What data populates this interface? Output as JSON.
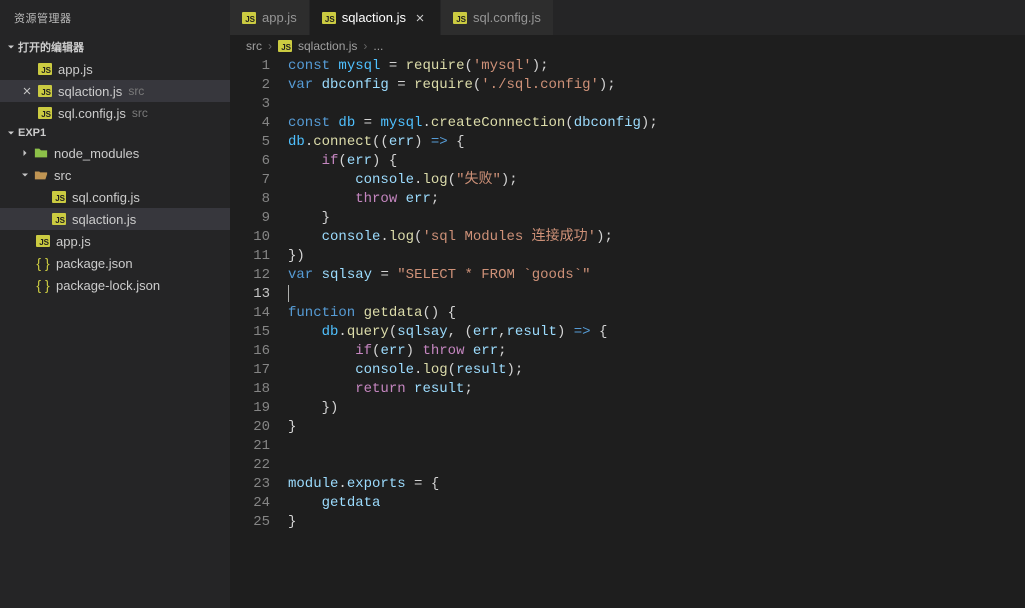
{
  "sidebar": {
    "title": "资源管理器",
    "openEditors": {
      "label": "打开的编辑器",
      "items": [
        {
          "name": "app.js",
          "meta": ""
        },
        {
          "name": "sqlaction.js",
          "meta": "src"
        },
        {
          "name": "sql.config.js",
          "meta": "src"
        }
      ]
    },
    "project": {
      "label": "EXP1",
      "tree": {
        "node_modules": "node_modules",
        "src": "src",
        "src_children": [
          {
            "name": "sql.config.js"
          },
          {
            "name": "sqlaction.js"
          }
        ],
        "root_files": [
          {
            "name": "app.js",
            "icon": "js"
          },
          {
            "name": "package.json",
            "icon": "json"
          },
          {
            "name": "package-lock.json",
            "icon": "json"
          }
        ]
      }
    }
  },
  "tabs": [
    {
      "name": "app.js",
      "active": false
    },
    {
      "name": "sqlaction.js",
      "active": true
    },
    {
      "name": "sql.config.js",
      "active": false
    }
  ],
  "breadcrumb": {
    "parts": [
      "src",
      "sqlaction.js"
    ],
    "ellipsis": "..."
  },
  "code": {
    "lines": [
      {
        "n": 1,
        "tokens": [
          [
            "kw",
            "const"
          ],
          [
            "sp",
            " "
          ],
          [
            "const",
            "mysql"
          ],
          [
            "sp",
            " "
          ],
          [
            "op",
            "="
          ],
          [
            "sp",
            " "
          ],
          [
            "fn",
            "require"
          ],
          [
            "punc",
            "("
          ],
          [
            "str",
            "'mysql'"
          ],
          [
            "punc",
            ");"
          ]
        ]
      },
      {
        "n": 2,
        "tokens": [
          [
            "kw",
            "var"
          ],
          [
            "sp",
            " "
          ],
          [
            "var",
            "dbconfig"
          ],
          [
            "sp",
            " "
          ],
          [
            "op",
            "="
          ],
          [
            "sp",
            " "
          ],
          [
            "fn",
            "require"
          ],
          [
            "punc",
            "("
          ],
          [
            "str",
            "'./sql.config'"
          ],
          [
            "punc",
            ");"
          ]
        ]
      },
      {
        "n": 3,
        "tokens": []
      },
      {
        "n": 4,
        "tokens": [
          [
            "kw",
            "const"
          ],
          [
            "sp",
            " "
          ],
          [
            "const",
            "db"
          ],
          [
            "sp",
            " "
          ],
          [
            "op",
            "="
          ],
          [
            "sp",
            " "
          ],
          [
            "const",
            "mysql"
          ],
          [
            "punc",
            "."
          ],
          [
            "fn",
            "createConnection"
          ],
          [
            "punc",
            "("
          ],
          [
            "var",
            "dbconfig"
          ],
          [
            "punc",
            ");"
          ]
        ]
      },
      {
        "n": 5,
        "tokens": [
          [
            "const",
            "db"
          ],
          [
            "punc",
            "."
          ],
          [
            "fn",
            "connect"
          ],
          [
            "punc",
            "(("
          ],
          [
            "var",
            "err"
          ],
          [
            "punc",
            ")"
          ],
          [
            "sp",
            " "
          ],
          [
            "kw",
            "=>"
          ],
          [
            "sp",
            " "
          ],
          [
            "punc",
            "{"
          ]
        ]
      },
      {
        "n": 6,
        "tokens": [
          [
            "sp",
            "    "
          ],
          [
            "kw2",
            "if"
          ],
          [
            "punc",
            "("
          ],
          [
            "var",
            "err"
          ],
          [
            "punc",
            ")"
          ],
          [
            "sp",
            " "
          ],
          [
            "punc",
            "{"
          ]
        ]
      },
      {
        "n": 7,
        "tokens": [
          [
            "sp",
            "        "
          ],
          [
            "var",
            "console"
          ],
          [
            "punc",
            "."
          ],
          [
            "fn",
            "log"
          ],
          [
            "punc",
            "("
          ],
          [
            "str",
            "\"失败\""
          ],
          [
            "punc",
            ");"
          ]
        ]
      },
      {
        "n": 8,
        "tokens": [
          [
            "sp",
            "        "
          ],
          [
            "kw2",
            "throw"
          ],
          [
            "sp",
            " "
          ],
          [
            "var",
            "err"
          ],
          [
            "punc",
            ";"
          ]
        ]
      },
      {
        "n": 9,
        "tokens": [
          [
            "sp",
            "    "
          ],
          [
            "punc",
            "}"
          ]
        ]
      },
      {
        "n": 10,
        "tokens": [
          [
            "sp",
            "    "
          ],
          [
            "var",
            "console"
          ],
          [
            "punc",
            "."
          ],
          [
            "fn",
            "log"
          ],
          [
            "punc",
            "("
          ],
          [
            "str",
            "'sql Modules 连接成功'"
          ],
          [
            "punc",
            ");"
          ]
        ]
      },
      {
        "n": 11,
        "tokens": [
          [
            "punc",
            "})"
          ]
        ]
      },
      {
        "n": 12,
        "tokens": [
          [
            "kw",
            "var"
          ],
          [
            "sp",
            " "
          ],
          [
            "var",
            "sqlsay"
          ],
          [
            "sp",
            " "
          ],
          [
            "op",
            "="
          ],
          [
            "sp",
            " "
          ],
          [
            "str",
            "\"SELECT * FROM `goods`\""
          ]
        ]
      },
      {
        "n": 13,
        "tokens": [],
        "cursor": true
      },
      {
        "n": 14,
        "tokens": [
          [
            "kw",
            "function"
          ],
          [
            "sp",
            " "
          ],
          [
            "fn",
            "getdata"
          ],
          [
            "punc",
            "()"
          ],
          [
            "sp",
            " "
          ],
          [
            "punc",
            "{"
          ]
        ]
      },
      {
        "n": 15,
        "tokens": [
          [
            "sp",
            "    "
          ],
          [
            "const",
            "db"
          ],
          [
            "punc",
            "."
          ],
          [
            "fn",
            "query"
          ],
          [
            "punc",
            "("
          ],
          [
            "var",
            "sqlsay"
          ],
          [
            "punc",
            ","
          ],
          [
            "sp",
            " "
          ],
          [
            "punc",
            "("
          ],
          [
            "var",
            "err"
          ],
          [
            "punc",
            ","
          ],
          [
            "var",
            "result"
          ],
          [
            "punc",
            ")"
          ],
          [
            "sp",
            " "
          ],
          [
            "kw",
            "=>"
          ],
          [
            "sp",
            " "
          ],
          [
            "punc",
            "{"
          ]
        ]
      },
      {
        "n": 16,
        "tokens": [
          [
            "sp",
            "        "
          ],
          [
            "kw2",
            "if"
          ],
          [
            "punc",
            "("
          ],
          [
            "var",
            "err"
          ],
          [
            "punc",
            ")"
          ],
          [
            "sp",
            " "
          ],
          [
            "kw2",
            "throw"
          ],
          [
            "sp",
            " "
          ],
          [
            "var",
            "err"
          ],
          [
            "punc",
            ";"
          ]
        ]
      },
      {
        "n": 17,
        "tokens": [
          [
            "sp",
            "        "
          ],
          [
            "var",
            "console"
          ],
          [
            "punc",
            "."
          ],
          [
            "fn",
            "log"
          ],
          [
            "punc",
            "("
          ],
          [
            "var",
            "result"
          ],
          [
            "punc",
            ");"
          ]
        ]
      },
      {
        "n": 18,
        "tokens": [
          [
            "sp",
            "        "
          ],
          [
            "kw2",
            "return"
          ],
          [
            "sp",
            " "
          ],
          [
            "var",
            "result"
          ],
          [
            "punc",
            ";"
          ]
        ]
      },
      {
        "n": 19,
        "tokens": [
          [
            "sp",
            "    "
          ],
          [
            "punc",
            "})"
          ]
        ]
      },
      {
        "n": 20,
        "tokens": [
          [
            "punc",
            "}"
          ]
        ]
      },
      {
        "n": 21,
        "tokens": []
      },
      {
        "n": 22,
        "tokens": []
      },
      {
        "n": 23,
        "tokens": [
          [
            "var",
            "module"
          ],
          [
            "punc",
            "."
          ],
          [
            "var",
            "exports"
          ],
          [
            "sp",
            " "
          ],
          [
            "op",
            "="
          ],
          [
            "sp",
            " "
          ],
          [
            "punc",
            "{"
          ]
        ]
      },
      {
        "n": 24,
        "tokens": [
          [
            "sp",
            "    "
          ],
          [
            "var",
            "getdata"
          ]
        ]
      },
      {
        "n": 25,
        "tokens": [
          [
            "punc",
            "}"
          ]
        ]
      }
    ]
  }
}
